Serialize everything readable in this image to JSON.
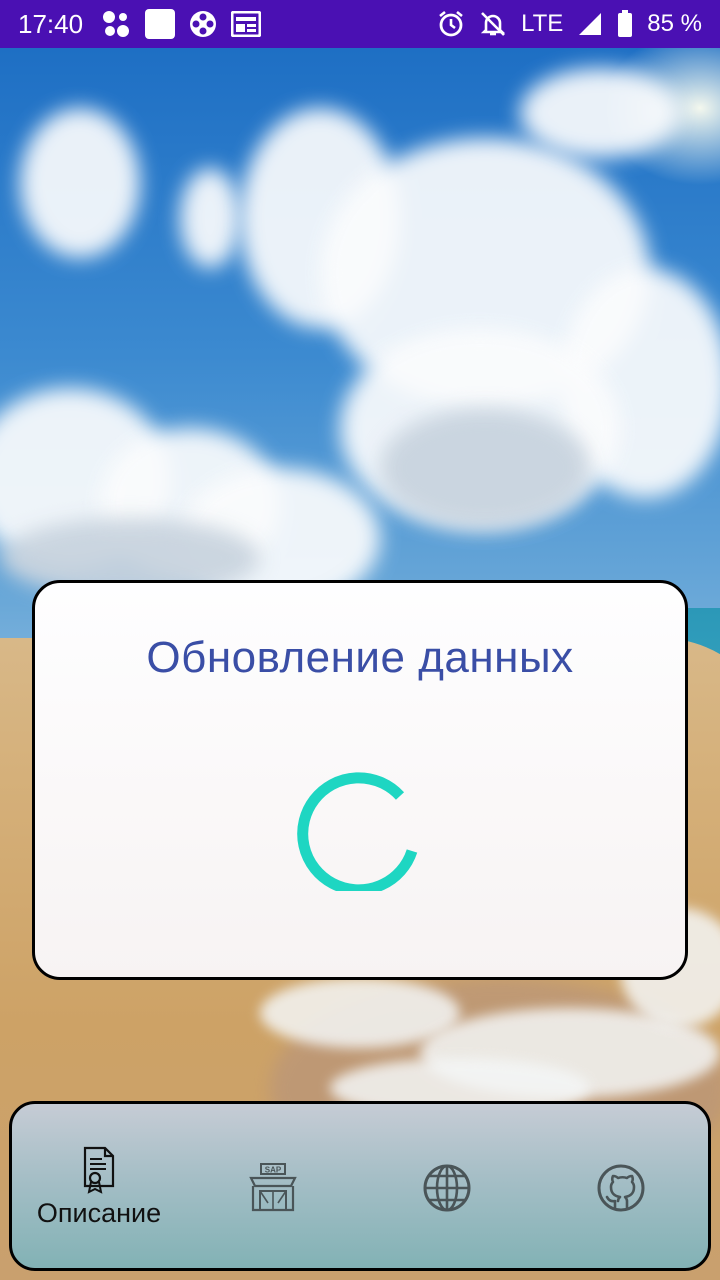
{
  "status_bar": {
    "time": "17:40",
    "left_icons": [
      "apps-dots-icon",
      "white-square-icon",
      "film-reel-icon",
      "news-icon"
    ],
    "right_icons": [
      "alarm-icon",
      "bell-off-icon",
      "signal-icon",
      "battery-icon"
    ],
    "network": "LTE",
    "battery": "85 %"
  },
  "dialog": {
    "title": "Обновление данных",
    "spinner_color": "#1ed6c2"
  },
  "bottom_nav": {
    "items": [
      {
        "label": "Описание",
        "icon": "certificate-document-icon",
        "selected": true
      },
      {
        "label": "",
        "icon": "sap-store-icon",
        "selected": false
      },
      {
        "label": "",
        "icon": "globe-icon",
        "selected": false
      },
      {
        "label": "",
        "icon": "github-icon",
        "selected": false
      }
    ]
  },
  "colors": {
    "status_bar": "#4a10b3",
    "title_text": "#3a4ea6",
    "card_border": "#000000"
  }
}
